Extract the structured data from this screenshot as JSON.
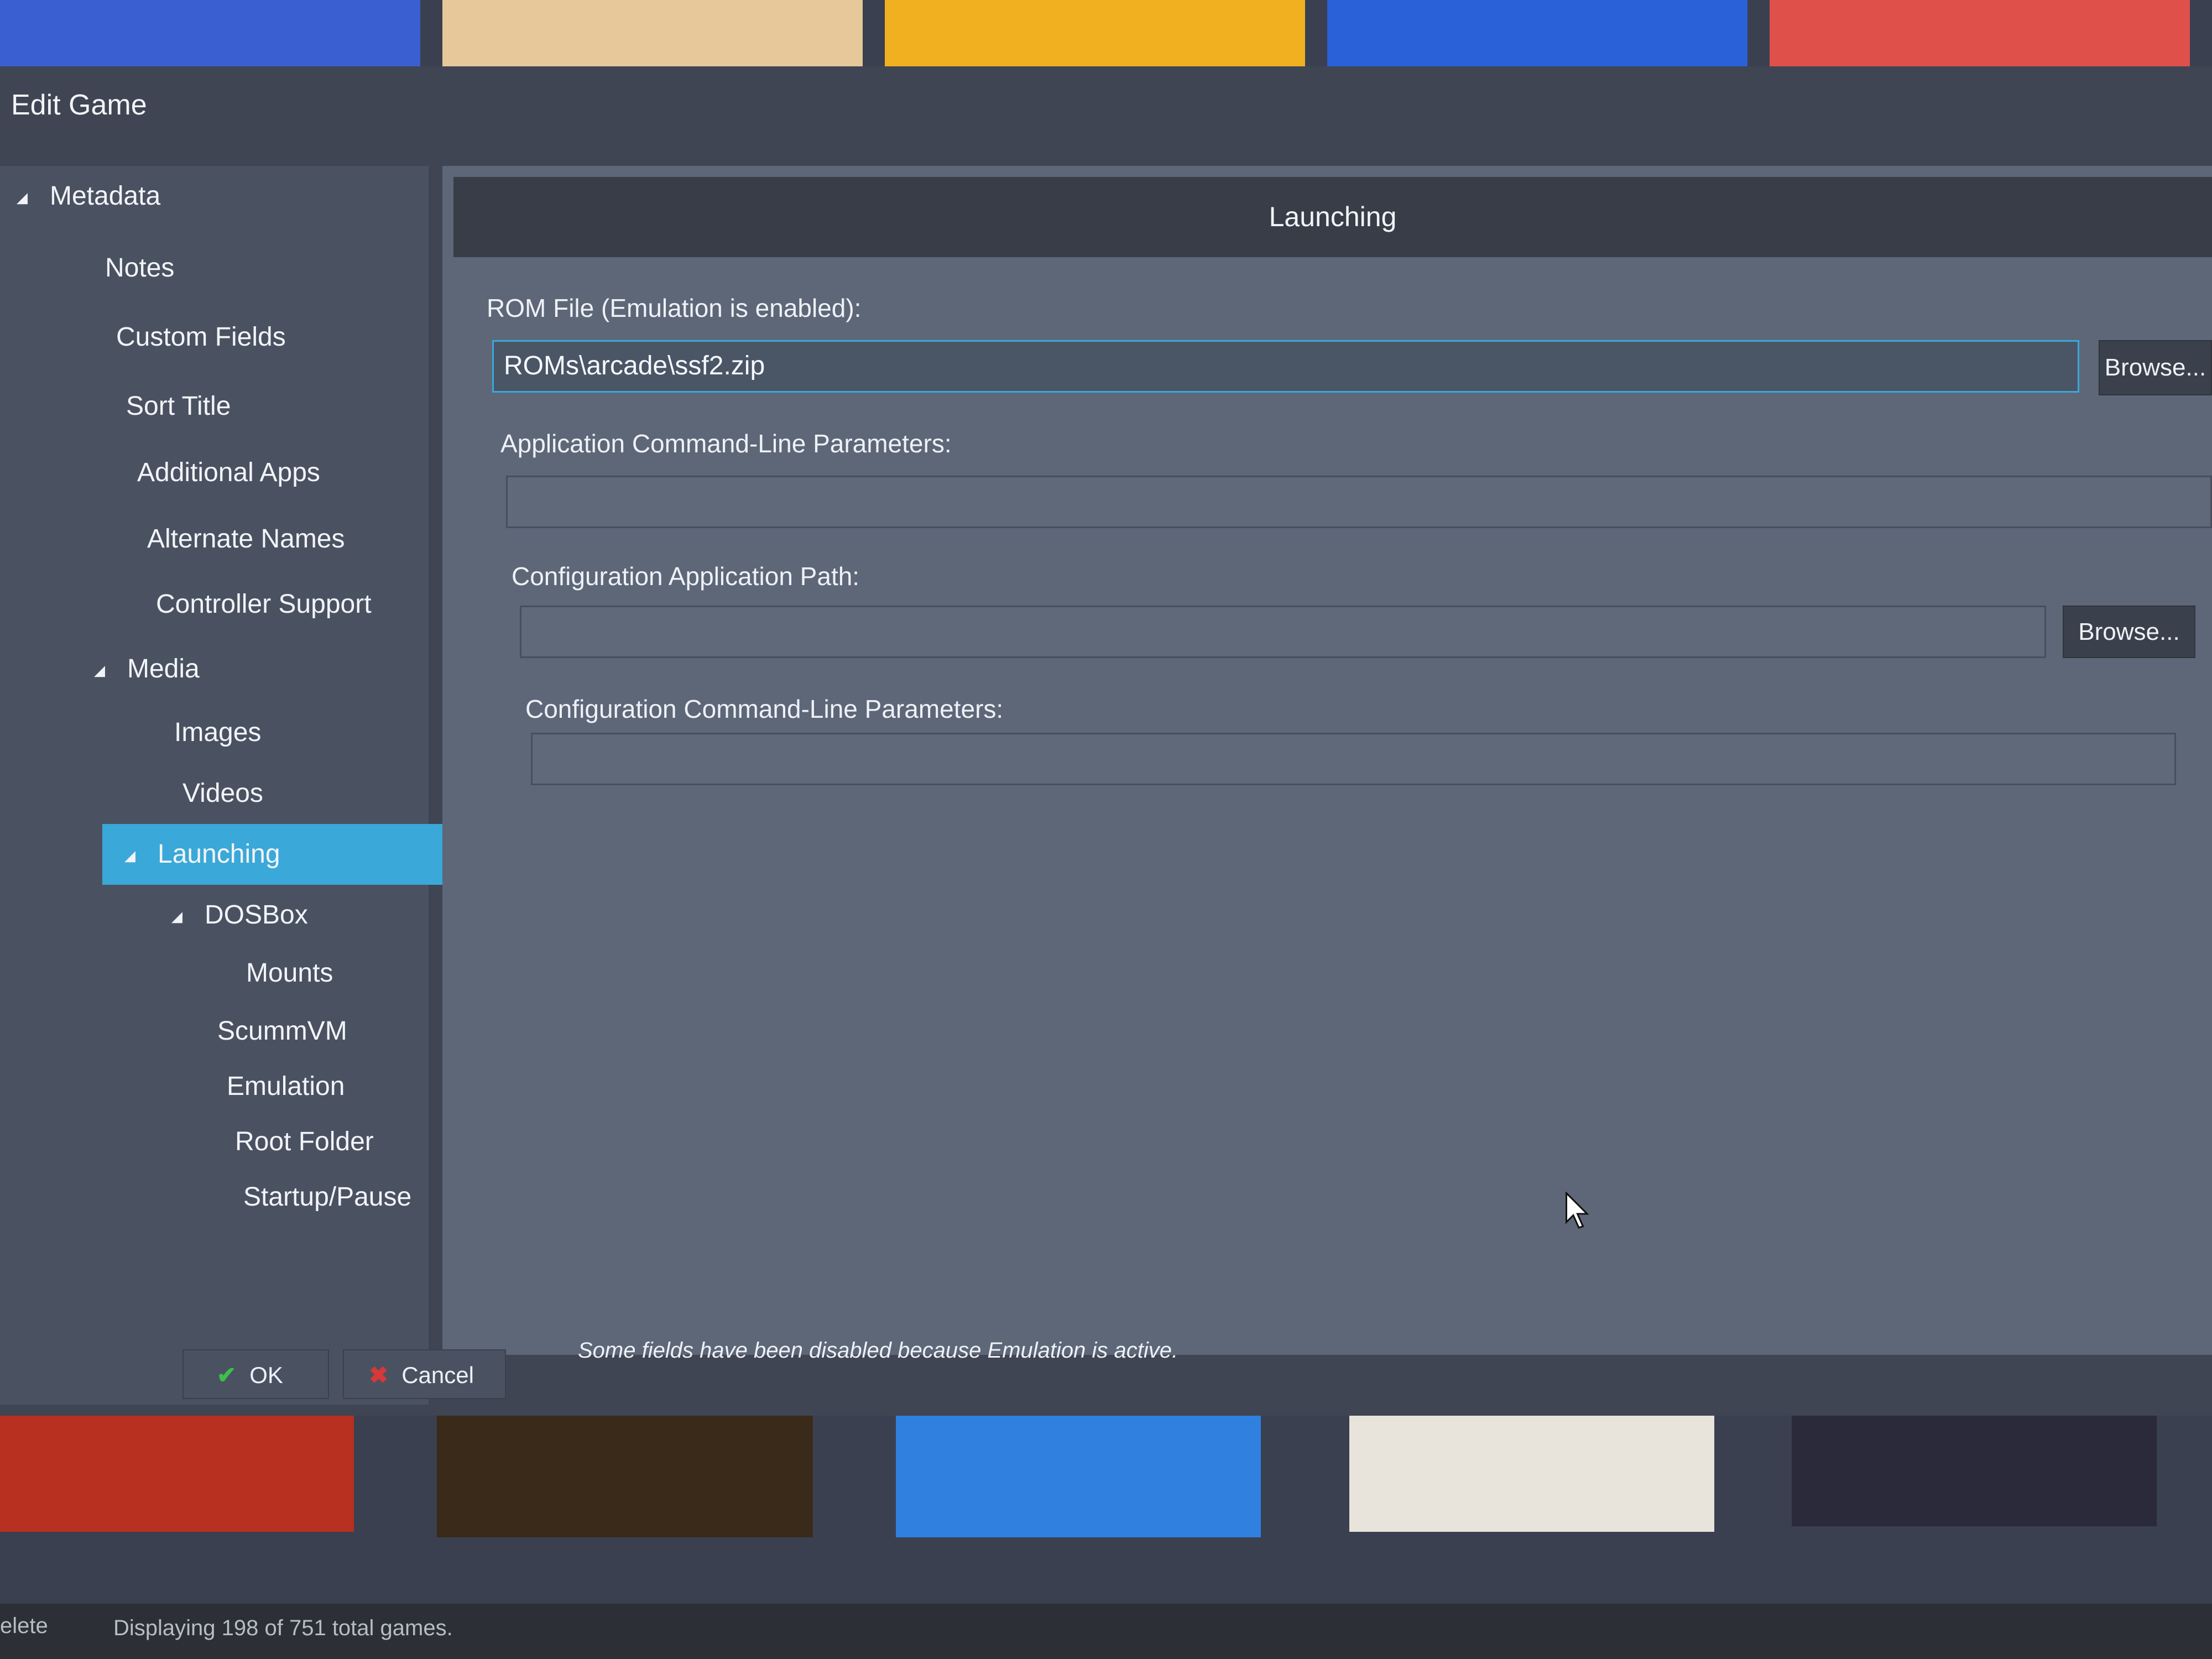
{
  "window": {
    "title": "Edit Game"
  },
  "nav": {
    "items": [
      {
        "label": "Metadata",
        "arrow": true
      },
      {
        "label": "Notes"
      },
      {
        "label": "Custom Fields"
      },
      {
        "label": "Sort Title"
      },
      {
        "label": "Additional Apps"
      },
      {
        "label": "Alternate Names"
      },
      {
        "label": "Controller Support"
      },
      {
        "label": "Media",
        "arrow": true
      },
      {
        "label": "Images"
      },
      {
        "label": "Videos"
      },
      {
        "label": "Launching",
        "arrow": true,
        "selected": true
      },
      {
        "label": "DOSBox",
        "arrow": true
      },
      {
        "label": "Mounts"
      },
      {
        "label": "ScummVM"
      },
      {
        "label": "Emulation"
      },
      {
        "label": "Root Folder"
      },
      {
        "label": "Startup/Pause"
      }
    ]
  },
  "panel": {
    "header": "Launching",
    "rom_label": "ROM File (Emulation is enabled):",
    "rom_value": "ROMs\\arcade\\ssf2.zip",
    "browse_label": "Browse...",
    "app_params_label": "Application Command-Line Parameters:",
    "app_params_value": "",
    "config_path_label": "Configuration Application Path:",
    "config_path_value": "",
    "config_browse_label": "Browse...",
    "config_params_label": "Configuration Command-Line Parameters:",
    "config_params_value": "",
    "note": "Some fields have been disabled because Emulation is active."
  },
  "footer": {
    "ok_label": "OK",
    "cancel_label": "Cancel"
  },
  "statusbar": {
    "delete_label": "elete",
    "count_text": "Displaying 198 of 751 total games."
  },
  "colors": {
    "accent": "#3aa8d8",
    "dialog_bg": "#3f4552",
    "panel_bg": "#5d6778"
  }
}
